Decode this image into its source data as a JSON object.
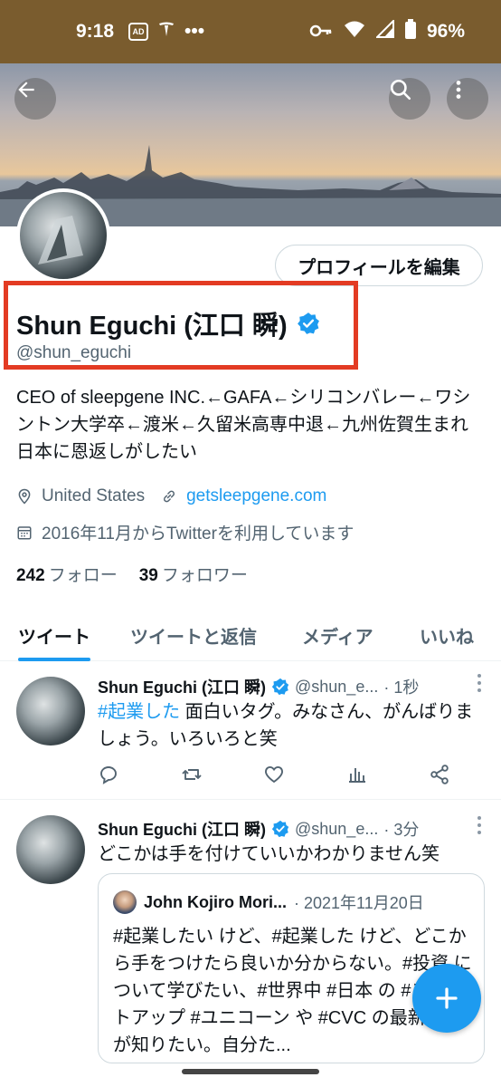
{
  "status_bar": {
    "time": "9:18",
    "ad_label": "AD",
    "dots": "•••",
    "battery": "96%"
  },
  "profile": {
    "edit_button": "プロフィールを編集",
    "name": "Shun Eguchi (江口 瞬)",
    "handle": "@shun_eguchi",
    "bio": "CEO of sleepgene INC.←GAFA←シリコンバレー←ワシントン大学卒←渡米←久留米高専中退←九州佐賀生まれ 日本に恩返しがしたい",
    "location": "United States",
    "website": "getsleepgene.com",
    "joined": "2016年11月からTwitterを利用しています",
    "following_count": "242",
    "following_label": "フォロー",
    "followers_count": "39",
    "followers_label": "フォロワー"
  },
  "tabs": [
    "ツイート",
    "ツイートと返信",
    "メディア",
    "いいね"
  ],
  "tweets": [
    {
      "name": "Shun Eguchi (江口 瞬)",
      "handle": "@shun_e...",
      "time": "· 1秒",
      "tag": "#起業した",
      "text": " 面白いタグ。みなさん、がんばりましょう。いろいろと笑"
    },
    {
      "name": "Shun Eguchi (江口 瞬)",
      "handle": "@shun_e...",
      "time": "· 3分",
      "text": "どこかは手を付けていいかわかりません笑",
      "quote": {
        "name": "John Kojiro Mori...",
        "date": "· 2021年11月20日",
        "text": "#起業したい けど、#起業した けど、どこから手をつけたら良いか分からない。#投資 について学びたい、#世界中 #日本 の #スタートアップ #ユニコーン や #CVC の最新情報 が知りたい。自分た..."
      }
    }
  ],
  "colors": {
    "accent": "#1d9bf0",
    "highlight": "#e33b23",
    "status_bar": "#7a5c2e"
  }
}
